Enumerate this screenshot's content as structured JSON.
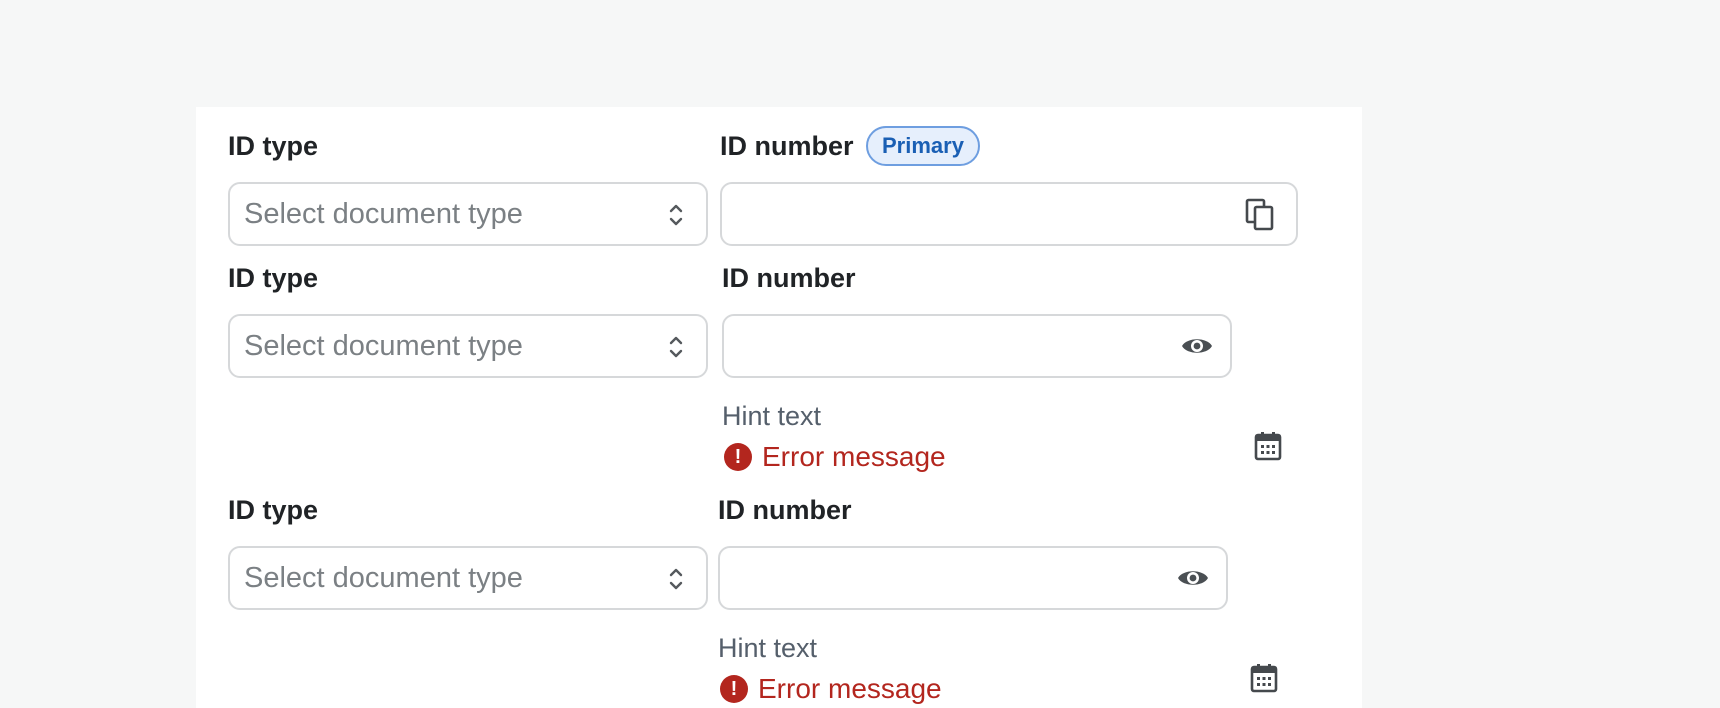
{
  "rows": [
    {
      "id_type_label": "ID type",
      "id_type_placeholder": "Select document type",
      "id_number_label": "ID number",
      "badge": "Primary",
      "field_icon": "copy-icon"
    },
    {
      "id_type_label": "ID type",
      "id_type_placeholder": "Select document type",
      "id_number_label": "ID number",
      "field_icon": "eye-icon",
      "hint": "Hint text",
      "error": "Error message",
      "side_icon": "calendar-icon"
    },
    {
      "id_type_label": "ID type",
      "id_type_placeholder": "Select document type",
      "id_number_label": "ID number",
      "field_icon": "eye-icon",
      "hint": "Hint text",
      "error": "Error message",
      "side_icon": "calendar-icon"
    }
  ],
  "colors": {
    "background": "#f6f7f7",
    "card": "#ffffff",
    "border": "#d6d8da",
    "placeholder": "#7b8084",
    "badge_bg": "#e6effc",
    "badge_text": "#1a5fb4",
    "error": "#b3261e",
    "hint": "#555f6b"
  }
}
